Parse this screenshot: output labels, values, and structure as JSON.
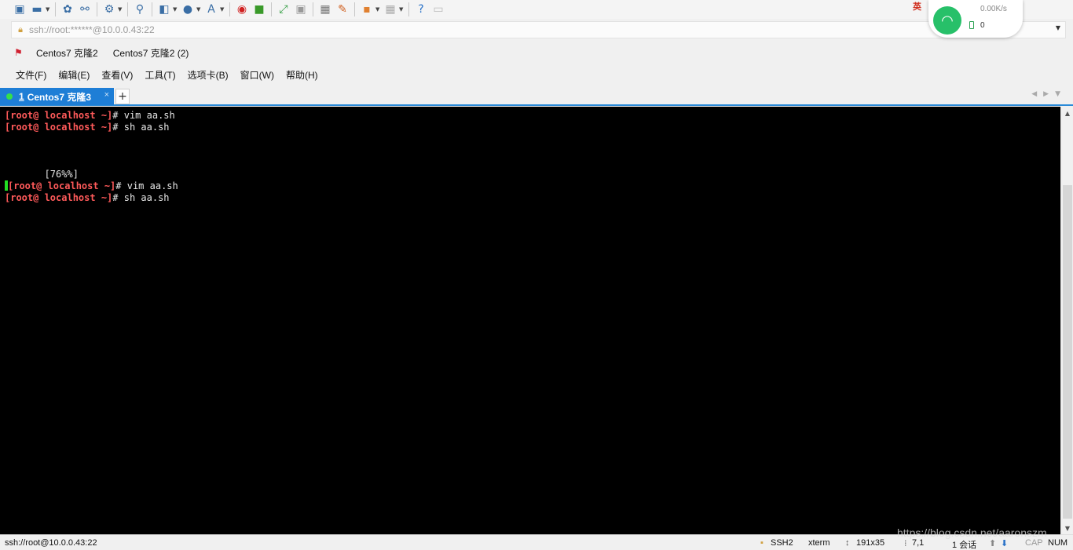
{
  "address": {
    "url": "ssh://root:******@10.0.0.43:22"
  },
  "network": {
    "speed": "0.00K/s",
    "count": "0"
  },
  "tray": {
    "ime": "英"
  },
  "bookmarks": [
    "Centos7 克隆2",
    "Centos7 克隆2 (2)"
  ],
  "menu": [
    "文件(F)",
    "编辑(E)",
    "查看(V)",
    "工具(T)",
    "选项卡(B)",
    "窗口(W)",
    "帮助(H)"
  ],
  "tab": {
    "number": "1",
    "title": "Centos7 克隆3",
    "close": "×",
    "add": "+"
  },
  "terminal": {
    "lines": [
      {
        "prompt": "[root@ localhost ~]",
        "text": "# vim aa.sh"
      },
      {
        "prompt": "[root@ localhost ~]",
        "text": "# sh aa.sh"
      },
      {
        "prompt": "",
        "text": ""
      },
      {
        "prompt": "",
        "text": ""
      },
      {
        "prompt": "",
        "text": ""
      },
      {
        "prompt": "",
        "text": "       [76%%]"
      },
      {
        "prompt": "[root@ localhost ~]",
        "text": "# vim aa.sh",
        "cursor": true
      },
      {
        "prompt": "[root@ localhost ~]",
        "text": "# sh aa.sh"
      }
    ]
  },
  "status": {
    "connection": "ssh://root@10.0.0.43:22",
    "protocol": "SSH2",
    "term": "xterm",
    "size": "191x35",
    "position": "7,1",
    "sessions": "1 会话",
    "cap": "CAP",
    "num": "NUM"
  },
  "watermark": "https://blog.csdn.net/aaronszm",
  "colors": {
    "accent": "#1e7ed6",
    "prompt": "#ff5a5a",
    "terminal_bg": "#000000",
    "cursor": "#22e022"
  }
}
